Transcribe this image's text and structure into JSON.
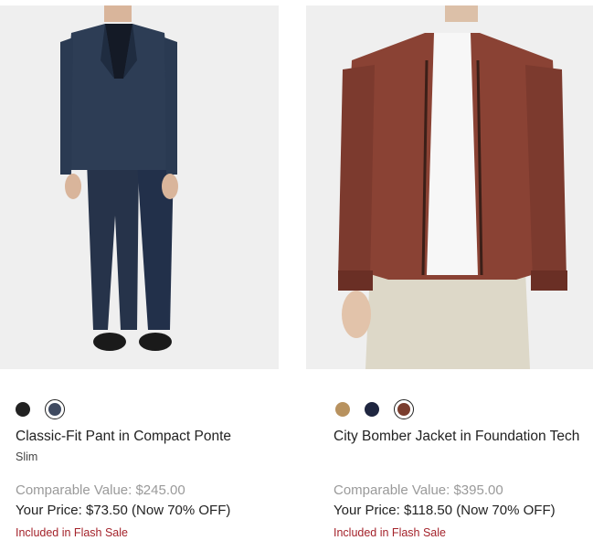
{
  "products": [
    {
      "name": "Classic-Fit Pant in Compact Ponte",
      "fit": "Slim",
      "comparable": "Comparable Value: $245.00",
      "price": "Your Price: $73.50 (Now 70% OFF)",
      "badge": "Included in Flash Sale",
      "swatches": [
        {
          "color": "#222222",
          "selected": false
        },
        {
          "color": "#3f4a60",
          "selected": true
        }
      ]
    },
    {
      "name": "City Bomber Jacket in Foundation Tech",
      "fit": "",
      "comparable": "Comparable Value: $395.00",
      "price": "Your Price: $118.50 (Now 70% OFF)",
      "badge": "Included in Flash Sale",
      "swatches": [
        {
          "color": "#b8925f",
          "selected": false
        },
        {
          "color": "#1f2640",
          "selected": false
        },
        {
          "color": "#7a3d2e",
          "selected": true
        }
      ]
    }
  ]
}
